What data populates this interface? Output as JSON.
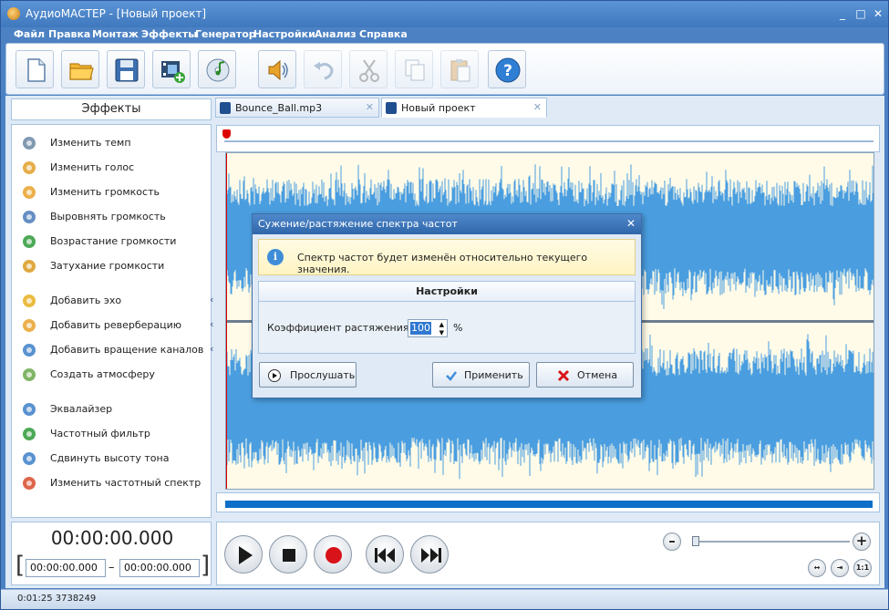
{
  "window": {
    "title": "АудиоМАСТЕР - [Новый проект]",
    "minimize_glyph": "_",
    "maximize_glyph": "□",
    "close_glyph": "✕"
  },
  "menu": [
    "Файл",
    "Правка",
    "Монтаж",
    "Эффекты",
    "Генератор",
    "Настройки",
    "Анализ",
    "Справка"
  ],
  "toolbar": {
    "buttons": [
      {
        "icon": "new-file-icon",
        "enabled": true
      },
      {
        "icon": "open-folder-icon",
        "enabled": true
      },
      {
        "icon": "save-icon",
        "enabled": true
      },
      {
        "icon": "add-video-icon",
        "enabled": true
      },
      {
        "icon": "cd-music-icon",
        "enabled": true
      },
      {
        "icon": "speaker-icon",
        "enabled": true
      },
      {
        "icon": "undo-icon",
        "enabled": false
      },
      {
        "icon": "cut-icon",
        "enabled": false
      },
      {
        "icon": "copy-icon",
        "enabled": false
      },
      {
        "icon": "paste-icon",
        "enabled": false
      },
      {
        "icon": "help-icon",
        "enabled": true
      }
    ]
  },
  "effects_panel": {
    "title": "Эффекты",
    "items": [
      {
        "label": "Изменить темп",
        "icon": "clock-icon",
        "submenu": false
      },
      {
        "label": "Изменить голос",
        "icon": "voice-person-icon",
        "submenu": false
      },
      {
        "label": "Изменить громкость",
        "icon": "volume-icon",
        "submenu": false
      },
      {
        "label": "Выровнять громкость",
        "icon": "normalize-icon",
        "submenu": false
      },
      {
        "label": "Возрастание громкости",
        "icon": "fade-in-icon",
        "submenu": false
      },
      {
        "label": "Затухание громкости",
        "icon": "fade-out-icon",
        "submenu": false
      },
      {
        "label": "Добавить эхо",
        "icon": "echo-icon",
        "submenu": true
      },
      {
        "label": "Добавить реверберацию",
        "icon": "reverb-icon",
        "submenu": true
      },
      {
        "label": "Добавить вращение каналов",
        "icon": "rotate-channels-icon",
        "submenu": true
      },
      {
        "label": "Создать атмосферу",
        "icon": "atmosphere-icon",
        "submenu": true
      },
      {
        "label": "Эквалайзер",
        "icon": "equalizer-icon",
        "submenu": false
      },
      {
        "label": "Частотный фильтр",
        "icon": "filter-icon",
        "submenu": false
      },
      {
        "label": "Сдвинуть высоту тона",
        "icon": "pitch-arrow-icon",
        "submenu": false
      },
      {
        "label": "Изменить частотный спектр",
        "icon": "spectrum-icon",
        "submenu": false
      }
    ],
    "submenu_glyph": "‹"
  },
  "tabs": [
    {
      "label": "Bounce_Ball.mp3",
      "active": false,
      "close": "✕"
    },
    {
      "label": "Новый проект",
      "active": true,
      "close": "✕"
    }
  ],
  "waveform": {
    "color": "#4a9ee0",
    "background": "#fffbe8"
  },
  "time": {
    "current": "00:00:00.000",
    "start": "00:00:00.000",
    "end": "00:00:00.000",
    "dash": "–",
    "bracket_left": "[",
    "bracket_right": "]"
  },
  "zoom": {
    "minus": "–",
    "plus": "+",
    "level": 0.0
  },
  "view_buttons": [
    "↔",
    "⇥",
    "1:1"
  ],
  "status": {
    "text": "0:01:25 3738249"
  },
  "dialog": {
    "title": "Сужение/растяжение спектра частот",
    "close": "✕",
    "info_icon": "i",
    "info_text": "Спектр частот будет изменён относительно текущего значения.",
    "settings_title": "Настройки",
    "coef_label": "Коэффициент растяжения:",
    "coef_value": "100",
    "unit": "%",
    "spin_up": "▲",
    "spin_down": "▼",
    "preview_label": "Прослушать",
    "apply_label": "Применить",
    "cancel_label": "Отмена"
  }
}
